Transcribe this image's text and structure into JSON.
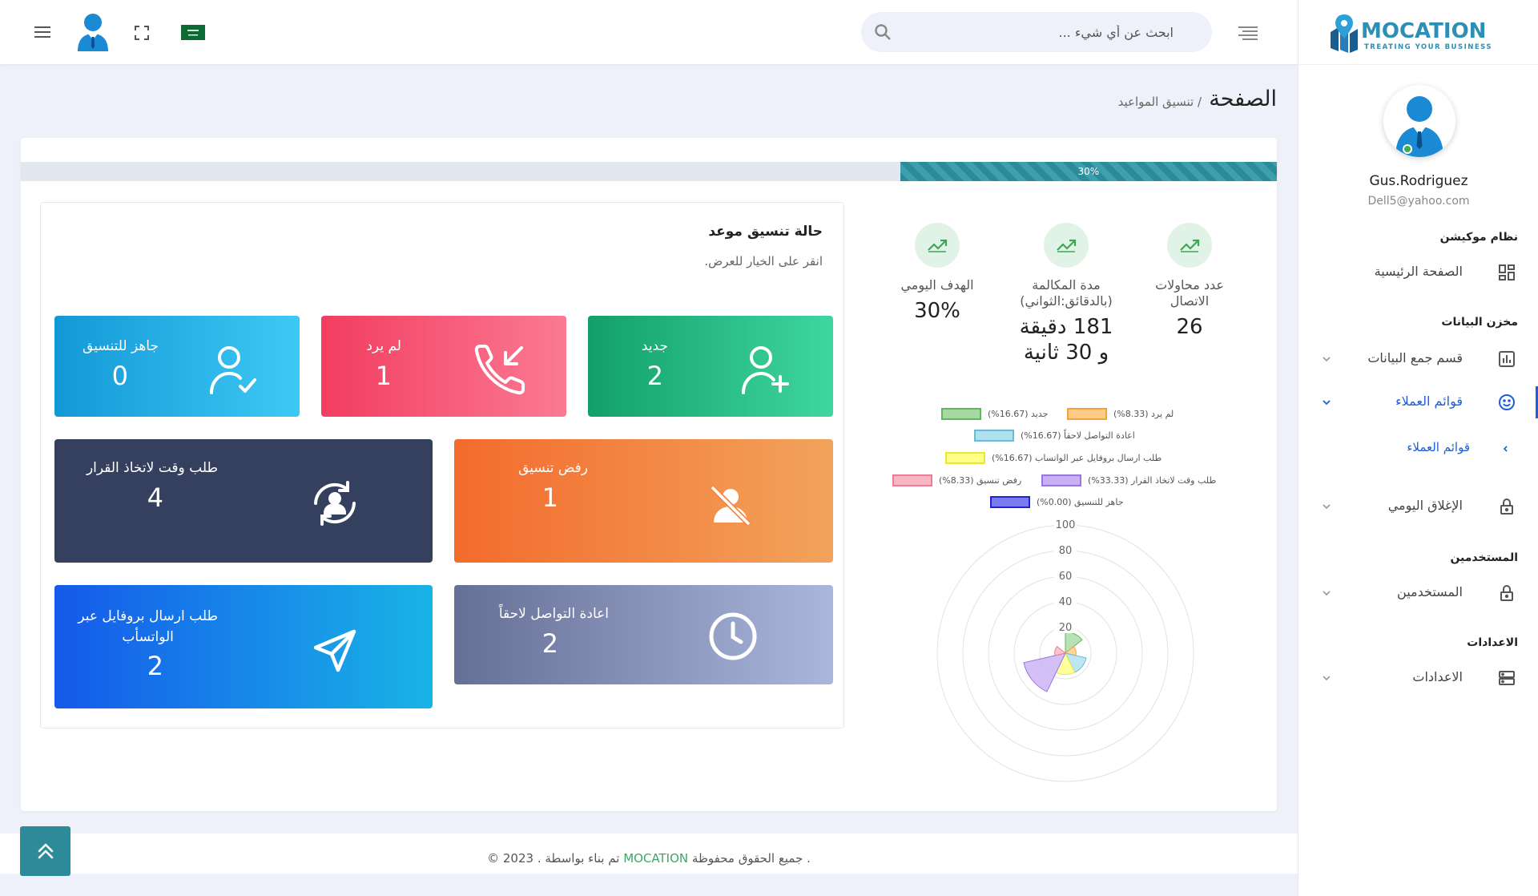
{
  "header": {
    "search_placeholder": "ابحث عن أي شيء ...",
    "flag": "flag-icon-saudi-arabia"
  },
  "sidebar": {
    "brand": "MOCATION",
    "tagline": "TREATING YOUR BUSINESS",
    "user_name": "Gus.Rodriguez",
    "user_email": "Dell5@yahoo.com",
    "sections": {
      "system": "نظام موكيشن",
      "data_store": "مخزن البيانات",
      "users": "المستخدمين",
      "settings": "الاعدادات"
    },
    "items": {
      "home": "الصفحة الرئيسية",
      "data_collection": "قسم جمع البيانات",
      "customer_lists": "قوائم العملاء",
      "customer_lists_sub": "قوائم العملاء",
      "daily_closing": "الإغلاق اليومي",
      "users": "المستخدمين",
      "settings": "الاعدادات"
    }
  },
  "page": {
    "title": "الصفحة",
    "breadcrumb": "/ تنسيق المواعيد"
  },
  "progress": {
    "label": "30%",
    "value": 0.3
  },
  "panel": {
    "title": "حالة تنسيق موعد",
    "subtitle": "انقر على الخيار للعرض."
  },
  "tiles": {
    "new": {
      "label": "جديد",
      "value": "2"
    },
    "no_answer": {
      "label": "لم يرد",
      "value": "1"
    },
    "ready": {
      "label": "جاهز للتنسيق",
      "value": "0"
    },
    "refused": {
      "label": "رفض تنسيق",
      "value": "1"
    },
    "decision_time": {
      "label": "طلب وقت لاتخاذ القرار",
      "value": "4"
    },
    "callback": {
      "label": "اعادة التواصل لاحقاً",
      "value": "2"
    },
    "whatsapp": {
      "label_line1": "طلب ارسال بروفايل عبر",
      "label_line2": "الواتسأب",
      "value": "2"
    }
  },
  "stats": {
    "attempts": {
      "label_line1": "عدد محاولات",
      "label_line2": "الاتصال",
      "value": "26"
    },
    "duration": {
      "label_line1": "مدة المكالمة",
      "label_line2": "(بالدقائق:الثواني)",
      "value_line1": "181 دقيقة",
      "value_line2": "و 30 ثانية"
    },
    "daily_goal": {
      "label": "الهدف اليومي",
      "value": "30%"
    }
  },
  "legend": {
    "new": "جديد (16.67%)",
    "no_answer": "لم يرد (8.33%)",
    "callback": "اعادة التواصل لاحقاً (16.67%)",
    "whatsapp": "طلب ارسال بروفايل عبر الواتساب (16.67%)",
    "decision": "طلب وقت لاتخاذ القرار (33.33%)",
    "refused": "رفض تنسيق (8.33%)",
    "ready": "جاهز للتنسيق (0.00%)"
  },
  "chart_data": {
    "type": "polarArea",
    "rlim": [
      0,
      100
    ],
    "ticks": [
      "20",
      "40",
      "60",
      "80",
      "100"
    ],
    "series": [
      {
        "name": "جديد",
        "value": 16.67,
        "fill": "#a6d9a2",
        "stroke": "#5fb85a"
      },
      {
        "name": "لم يرد",
        "value": 8.33,
        "fill": "#ffcb8a",
        "stroke": "#f5a236"
      },
      {
        "name": "اعادة التواصل لاحقاً",
        "value": 16.67,
        "fill": "#aee0ef",
        "stroke": "#6dbad6"
      },
      {
        "name": "طلب ارسال بروفايل عبر الواتساب",
        "value": 16.67,
        "fill": "#ffff85",
        "stroke": "#e8e83a"
      },
      {
        "name": "طلب وقت لاتخاذ القرار",
        "value": 33.33,
        "fill": "#c9b0f5",
        "stroke": "#9a75e0"
      },
      {
        "name": "رفض تنسيق",
        "value": 8.33,
        "fill": "#f8b6c4",
        "stroke": "#ec7b93"
      },
      {
        "name": "جاهز للتنسيق",
        "value": 0.0,
        "fill": "#7b7bf0",
        "stroke": "#2222d8"
      }
    ]
  },
  "footer": {
    "prefix": "© 2023 . تم بناء بواسطة ",
    "brand": "MOCATION",
    "suffix": " جميع الحقوق محفوظة ."
  }
}
